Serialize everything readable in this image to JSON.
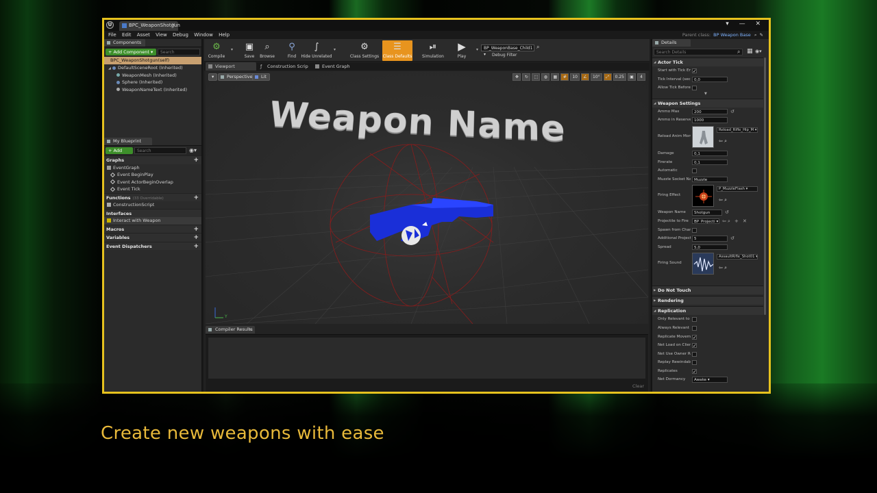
{
  "caption": "Create new weapons with ease",
  "window": {
    "tab_title": "BPC_WeaponShotgun",
    "controls": "▾ — ✕"
  },
  "menu": [
    "File",
    "Edit",
    "Asset",
    "View",
    "Debug",
    "Window",
    "Help"
  ],
  "parent_class": {
    "label": "Parent class:",
    "value": "BP Weapon Base"
  },
  "components": {
    "tab": "Components",
    "add_label": "+ Add Component ▾",
    "search_placeholder": "Search",
    "self_item": "BPC_WeaponShotgun(self)",
    "tree": [
      "DefaultSceneRoot (Inherited)",
      "WeaponMesh (Inherited)",
      "Sphere (Inherited)",
      "WeaponNameText (Inherited)"
    ]
  },
  "my_blueprint": {
    "tab": "My Blueprint",
    "add_label": "+ Add New ▾",
    "search_placeholder": "Search",
    "graphs_label": "Graphs",
    "event_graph": "EventGraph",
    "events": [
      "Event BeginPlay",
      "Event ActorBeginOverlap",
      "Event Tick"
    ],
    "functions_label": "Functions",
    "functions_sub": "(33 Overridable)",
    "construction_script": "ConstructionScript",
    "interfaces_label": "Interfaces",
    "interface_item": "Interact with Weapon",
    "macros_label": "Macros",
    "variables_label": "Variables",
    "dispatchers_label": "Event Dispatchers"
  },
  "toolbar": {
    "compile": "Compile",
    "save": "Save",
    "browse": "Browse",
    "find": "Find",
    "hide_unrelated": "Hide Unrelated",
    "class_settings": "Class Settings",
    "class_defaults": "Class Defaults",
    "simulation": "Simulation",
    "play": "Play",
    "debug_object": "BP_WeaponBase_Child1 ▾",
    "debug_filter": "Debug Filter"
  },
  "editor_tabs": {
    "viewport": "Viewport",
    "construction": "Construction Scrip",
    "event_graph": "Event Graph"
  },
  "viewport": {
    "perspective": "Perspective",
    "lit": "Lit",
    "grid_snap": "10",
    "rot_snap": "10°",
    "scale_snap": "0.25",
    "cam_speed": "4",
    "weapon_name_text": "Weapon Name",
    "axis_y": "Y"
  },
  "compiler": {
    "tab": "Compiler Results",
    "clear": "Clear"
  },
  "details": {
    "tab": "Details",
    "search_placeholder": "Search Details",
    "actor_tick": {
      "label": "Actor Tick",
      "start_with_tick": "Start with Tick Ena",
      "tick_interval": "Tick Interval (secs",
      "tick_interval_value": "0,0",
      "allow_tick": "Allow Tick Before I"
    },
    "weapon_settings": {
      "label": "Weapon Settings",
      "ammo_max": "Ammo Max",
      "ammo_max_value": "200",
      "ammo_reserve": "Ammo in Reserve",
      "ammo_reserve_value": "1000",
      "reload_anim": "Reload Anim Mont",
      "reload_anim_value": "Reload_Rifle_Hip_M ▾",
      "damage": "Damage",
      "damage_value": "0,1",
      "firerate": "Firerate",
      "firerate_value": "0,1",
      "automatic": "Automatic",
      "muzzle_socket": "Muzzle Socket Na",
      "muzzle_socket_value": "Muzzle",
      "firing_effect": "Firing Effect",
      "firing_effect_value": "P_MuzzleFlash ▾",
      "weapon_name": "Weapon Name",
      "weapon_name_value": "Shotgun",
      "projectile": "Projectile to Fire",
      "projectile_value": "BP_Projecti ▾",
      "spawn_from": "Spawn from Chara",
      "additional": "Additional Projecti",
      "additional_value": "5",
      "spread": "Spread",
      "spread_value": "5,0",
      "firing_sound": "Firing Sound",
      "firing_sound_value": "AssaultRifle_Shot01 ▾"
    },
    "do_not_touch": "Do Not Touch",
    "rendering": "Rendering",
    "replication": {
      "label": "Replication",
      "only_relevant": "Only Relevant to O",
      "always_relevant": "Always Relevant",
      "replicate_movement": "Replicate Moveme",
      "net_load": "Net Load on Client",
      "net_use_owner": "Net Use Owner Rel",
      "replay_rewindable": "Replay Rewindable",
      "replicates": "Replicates",
      "net_dormancy": "Net Dormancy",
      "net_dormancy_value": "Awake ▾"
    }
  },
  "colors": {
    "frame_border": "#e6c21e",
    "caption": "#e8b93a",
    "class_defaults_active": "#e8941e",
    "weapon_mesh": "#1a2fd8"
  }
}
